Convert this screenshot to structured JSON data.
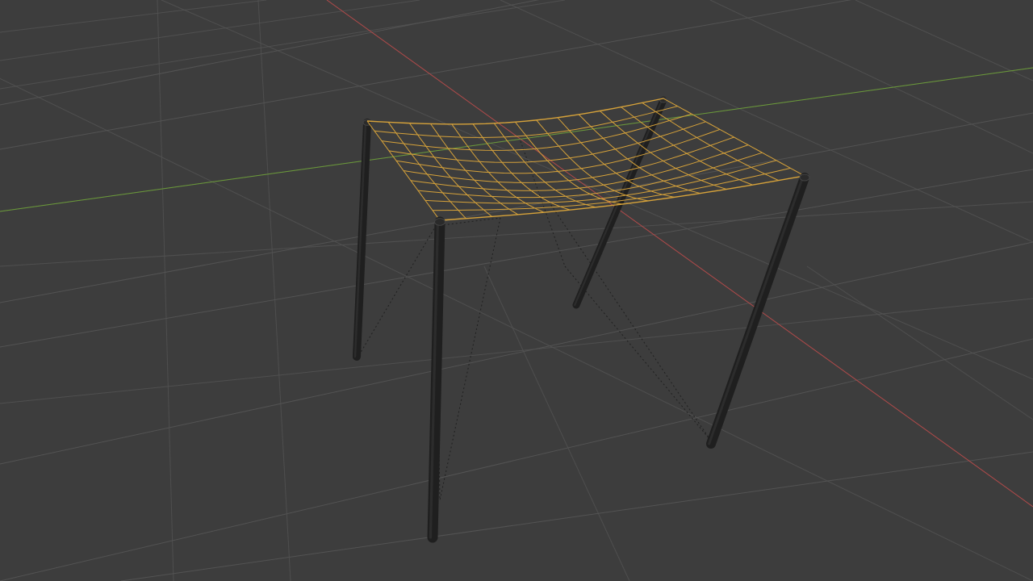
{
  "viewport": {
    "mode": "3d-viewport",
    "background_color": "#3d3d3d"
  },
  "grid": {
    "visible": true,
    "line_color": "#535353"
  },
  "axes": {
    "x_axis": {
      "color": "#b04a4a"
    },
    "y_axis": {
      "color": "#6a9a38"
    }
  },
  "scene": {
    "cloth": {
      "selected": true,
      "wire_color": "#d6a23a",
      "rows": 10,
      "cols": 14
    },
    "poles": [
      {
        "name": "pole-left-back",
        "color": "#1f1f1f"
      },
      {
        "name": "pole-front",
        "color": "#1f1f1f"
      },
      {
        "name": "pole-back-right",
        "color": "#1f1f1f"
      },
      {
        "name": "pole-right",
        "color": "#1f1f1f"
      }
    ],
    "guide_lines": {
      "style": "dotted",
      "color": "#202020"
    }
  }
}
